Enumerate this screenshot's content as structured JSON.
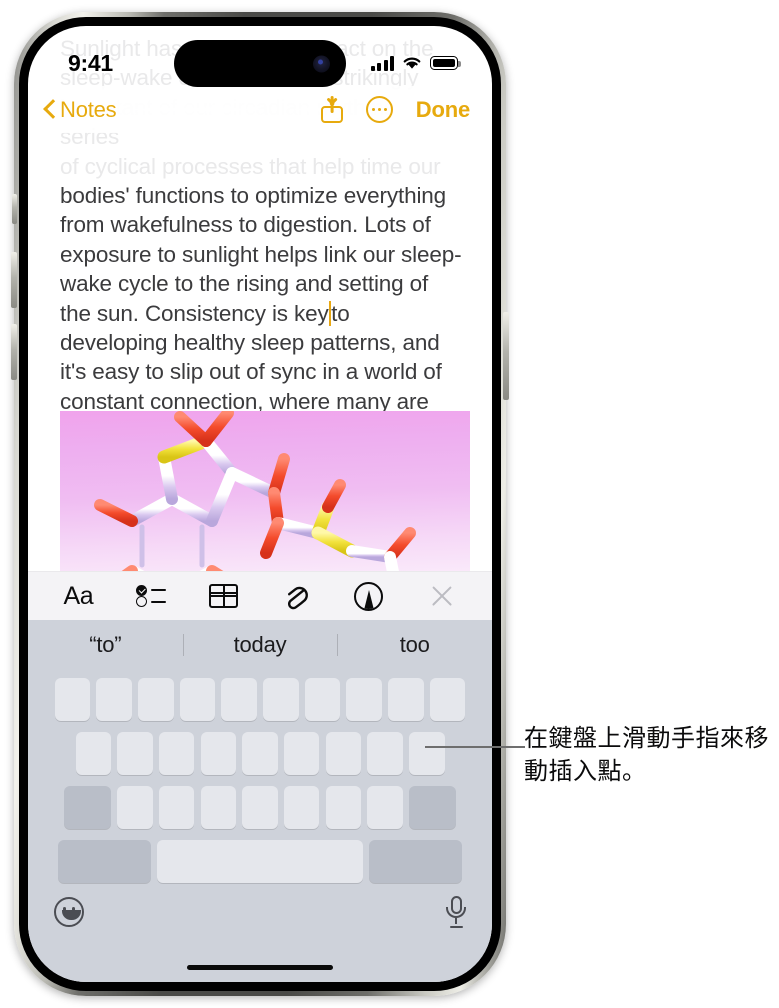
{
  "status_bar": {
    "time": "9:41",
    "cellular_icon": "cellular-bars-icon",
    "wifi_icon": "wifi-icon",
    "battery_icon": "battery-full-icon"
  },
  "nav_bar": {
    "back_label": "Notes",
    "back_icon": "chevron-left-icon",
    "share_icon": "share-icon",
    "more_icon": "more-ellipsis-icon",
    "done_label": "Done"
  },
  "note": {
    "faded_lines": [
      "Sunlight has a profound impact on the",
      "sleep-wake cycle, the most strikingly",
      "important of our circadian rhythms—a series",
      "of cyclical processes that help time our"
    ],
    "body_before_caret": "bodies' functions to optimize everything from wakefulness to digestion. Lots of exposure to sunlight helps link our sleep-wake cycle to the rising and setting of the sun. Consistency is key",
    "body_after_caret": "to developing healthy sleep patterns, and it's easy to slip out of sync in a world of constant connection, where many are used to working across multiple timezones.",
    "attachment_name": "molecule-image"
  },
  "editor_toolbar": {
    "items": [
      {
        "label": "Aa",
        "name": "format-text-button"
      },
      {
        "label": "",
        "name": "checklist-button"
      },
      {
        "label": "",
        "name": "table-button"
      },
      {
        "label": "",
        "name": "attachment-button"
      },
      {
        "label": "",
        "name": "markup-button"
      },
      {
        "label": "",
        "name": "close-toolbar-button"
      }
    ]
  },
  "predictive_bar": {
    "suggestions": [
      "“to”",
      "today",
      "too"
    ]
  },
  "keyboard": {
    "row1_keys": 10,
    "row2_keys": 9,
    "row3_letter_keys": 7,
    "shift_key": "shift-key",
    "delete_key": "delete-key",
    "numbers_key": "numbers-key",
    "space_key": "space-key",
    "return_key": "return-key",
    "emoji_icon": "emoji-icon",
    "dictation_icon": "microphone-icon",
    "mode": "trackpad-blank"
  },
  "callout": {
    "text": "在鍵盤上滑動手指來移動插入點。"
  },
  "colors": {
    "accent": "#e7aa0e",
    "keyboard_bg": "#ced2da",
    "key_bg": "#e5e7ec",
    "key_mod_bg": "#b9bec8",
    "toolbar_bg": "#f4f3f6",
    "text": "#3b3b3d",
    "caret": "#e8a712"
  }
}
